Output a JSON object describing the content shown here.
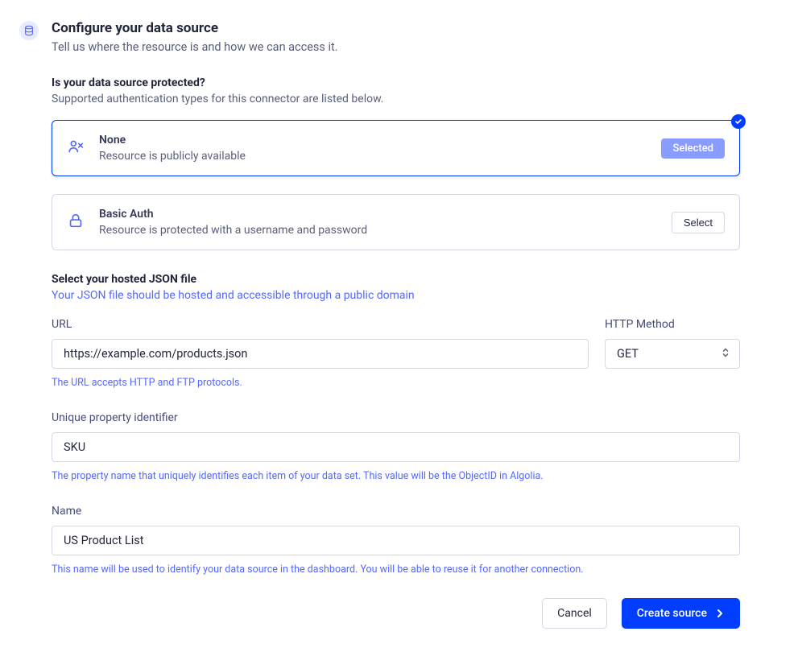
{
  "header": {
    "title": "Configure your data source",
    "subtitle": "Tell us where the resource is and how we can access it."
  },
  "auth_section": {
    "title": "Is your data source protected?",
    "subtitle": "Supported authentication types for this connector are listed below.",
    "options": [
      {
        "title": "None",
        "desc": "Resource is publicly available",
        "badge": "Selected"
      },
      {
        "title": "Basic Auth",
        "desc": "Resource is protected with a username and password",
        "button": "Select"
      }
    ]
  },
  "json_section": {
    "title": "Select your hosted JSON file",
    "subtitle": "Your JSON file should be hosted and accessible through a public domain",
    "url": {
      "label": "URL",
      "value": "https://example.com/products.json",
      "hint": "The URL accepts HTTP and FTP protocols."
    },
    "method": {
      "label": "HTTP Method",
      "value": "GET"
    },
    "identifier": {
      "label": "Unique property identifier",
      "value": "SKU",
      "hint": "The property name that uniquely identifies each item of your data set. This value will be the ObjectID in Algolia."
    },
    "name": {
      "label": "Name",
      "value": "US Product List",
      "hint": "This name will be used to identify your data source in the dashboard. You will be able to reuse it for another connection."
    }
  },
  "actions": {
    "cancel": "Cancel",
    "submit": "Create source"
  }
}
